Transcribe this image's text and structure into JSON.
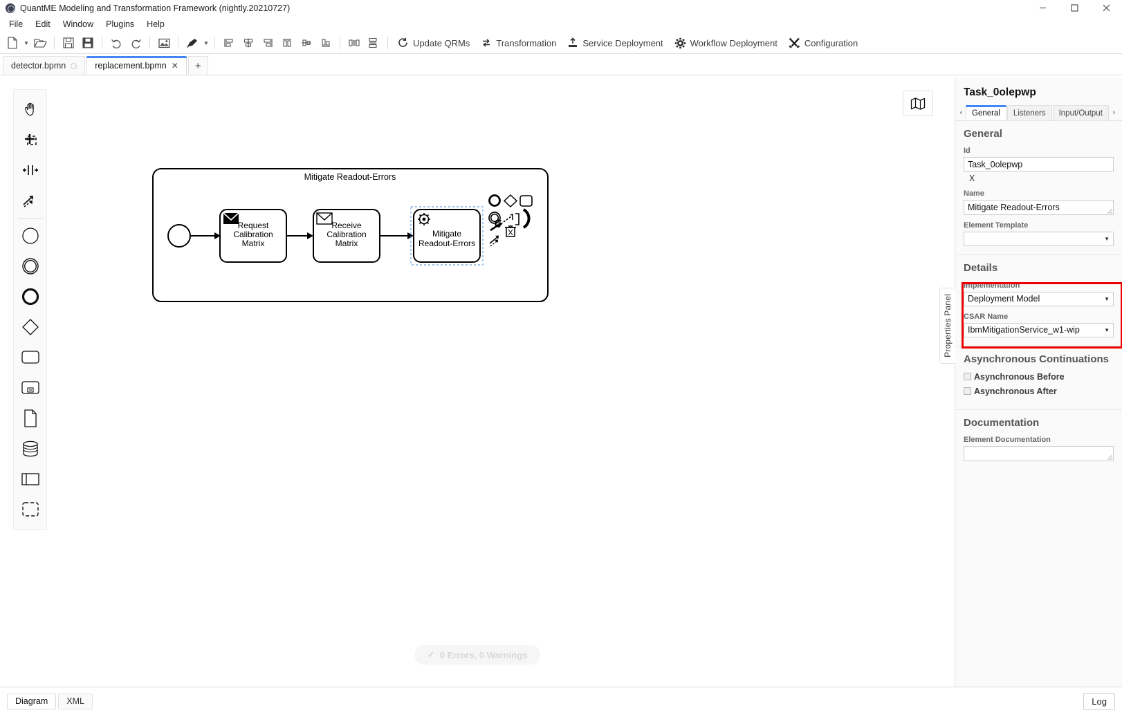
{
  "window": {
    "title": "QuantME Modeling and Transformation Framework (nightly.20210727)",
    "app_icon": "quantme-logo-icon",
    "controls": {
      "minimize": "minimize-icon",
      "maximize": "maximize-icon",
      "close": "close-icon"
    }
  },
  "menubar": {
    "items": [
      "File",
      "Edit",
      "Window",
      "Plugins",
      "Help"
    ]
  },
  "toolbar": {
    "icon_buttons": [
      {
        "name": "new-file-icon",
        "caret": true
      },
      {
        "name": "open-file-icon",
        "caret": false
      },
      {
        "name": "save-icon",
        "caret": false
      },
      {
        "name": "save-as-icon",
        "caret": false
      },
      {
        "name": "undo-icon",
        "caret": false
      },
      {
        "name": "redo-icon",
        "caret": false
      },
      {
        "name": "export-image-icon",
        "caret": false
      },
      {
        "name": "set-color-icon",
        "caret": true
      },
      {
        "name": "align-left-icon",
        "caret": false
      },
      {
        "name": "align-center-icon",
        "caret": false
      },
      {
        "name": "align-right-icon",
        "caret": false
      },
      {
        "name": "align-top-icon",
        "caret": false
      },
      {
        "name": "align-middle-icon",
        "caret": false
      },
      {
        "name": "align-bottom-icon",
        "caret": false
      },
      {
        "name": "distribute-horizontally-icon",
        "caret": false
      },
      {
        "name": "distribute-vertically-icon",
        "caret": false
      }
    ],
    "actions": [
      {
        "label": "Update QRMs",
        "icon": "refresh-icon"
      },
      {
        "label": "Transformation",
        "icon": "transform-icon"
      },
      {
        "label": "Service Deployment",
        "icon": "upload-icon"
      },
      {
        "label": "Workflow Deployment",
        "icon": "gear-icon"
      },
      {
        "label": "Configuration",
        "icon": "tools-icon"
      }
    ]
  },
  "tabs": {
    "items": [
      {
        "label": "detector.bpmn",
        "active": false,
        "indicator": "unsaved-dot-icon"
      },
      {
        "label": "replacement.bpmn",
        "active": true,
        "indicator": "close-icon"
      }
    ],
    "add_label": "+"
  },
  "palette": {
    "tools": [
      "hand-tool-icon",
      "lasso-tool-icon",
      "space-tool-icon",
      "global-connect-tool-icon"
    ],
    "elements": [
      "start-event-icon",
      "intermediate-event-icon",
      "end-event-icon",
      "exclusive-gateway-icon",
      "task-icon",
      "subprocess-expanded-icon",
      "data-object-icon",
      "data-store-icon",
      "participant-icon",
      "group-icon"
    ]
  },
  "canvas": {
    "minimap_toggle_icon": "map-icon",
    "status": {
      "icon": "check-icon",
      "text": "0 Errors, 0 Warnings"
    },
    "diagram": {
      "subprocess_label": "Mitigate Readout-Errors",
      "start_event": "start-event",
      "tasks": [
        {
          "id": "task-request",
          "label": "Request\nCalibration\nMatrix",
          "marker": "send-task-icon"
        },
        {
          "id": "task-receive",
          "label": "Receive\nCalibration\nMatrix",
          "marker": "receive-task-icon"
        },
        {
          "id": "task-mitigate",
          "label": "Mitigate\nReadout-Errors",
          "marker": "quantme-task-icon",
          "selected": true
        }
      ],
      "context_pad": [
        "append-end-event-icon",
        "append-gateway-icon",
        "append-task-icon",
        "append-intermediate-event-icon",
        "connect-icon",
        "append-text-annotation-icon",
        "wrench-icon",
        "delete-icon",
        "replace-icon",
        "global-connect-icon"
      ]
    }
  },
  "properties": {
    "handle_label": "Properties Panel",
    "element_title": "Task_0olepwp",
    "tabs": [
      "General",
      "Listeners",
      "Input/Output"
    ],
    "active_tab": "General",
    "prev_arrow": "chevron-left-icon",
    "next_arrow": "chevron-right-icon",
    "general": {
      "heading": "General",
      "id_label": "Id",
      "id_value": "Task_0olepwp",
      "id_clear": "X",
      "name_label": "Name",
      "name_value": "Mitigate Readout-Errors",
      "element_template_label": "Element Template",
      "element_template_value": ""
    },
    "details": {
      "heading": "Details",
      "implementation_label": "Implementation",
      "implementation_value": "Deployment Model",
      "csar_label": "CSAR Name",
      "csar_value": "IbmMitigationService_w1-wip",
      "highlight_color": "#ef0000"
    },
    "async": {
      "heading": "Asynchronous Continuations",
      "before_label": "Asynchronous Before",
      "before_checked": false,
      "after_label": "Asynchronous After",
      "after_checked": false
    },
    "documentation": {
      "heading": "Documentation",
      "label": "Element Documentation",
      "value": ""
    }
  },
  "bottombar": {
    "tabs": [
      {
        "label": "Diagram",
        "active": true
      },
      {
        "label": "XML",
        "active": false
      }
    ],
    "log_label": "Log"
  },
  "colors": {
    "accent": "#4285f4",
    "highlight": "#ef0000",
    "selection": "#66a3e0"
  }
}
